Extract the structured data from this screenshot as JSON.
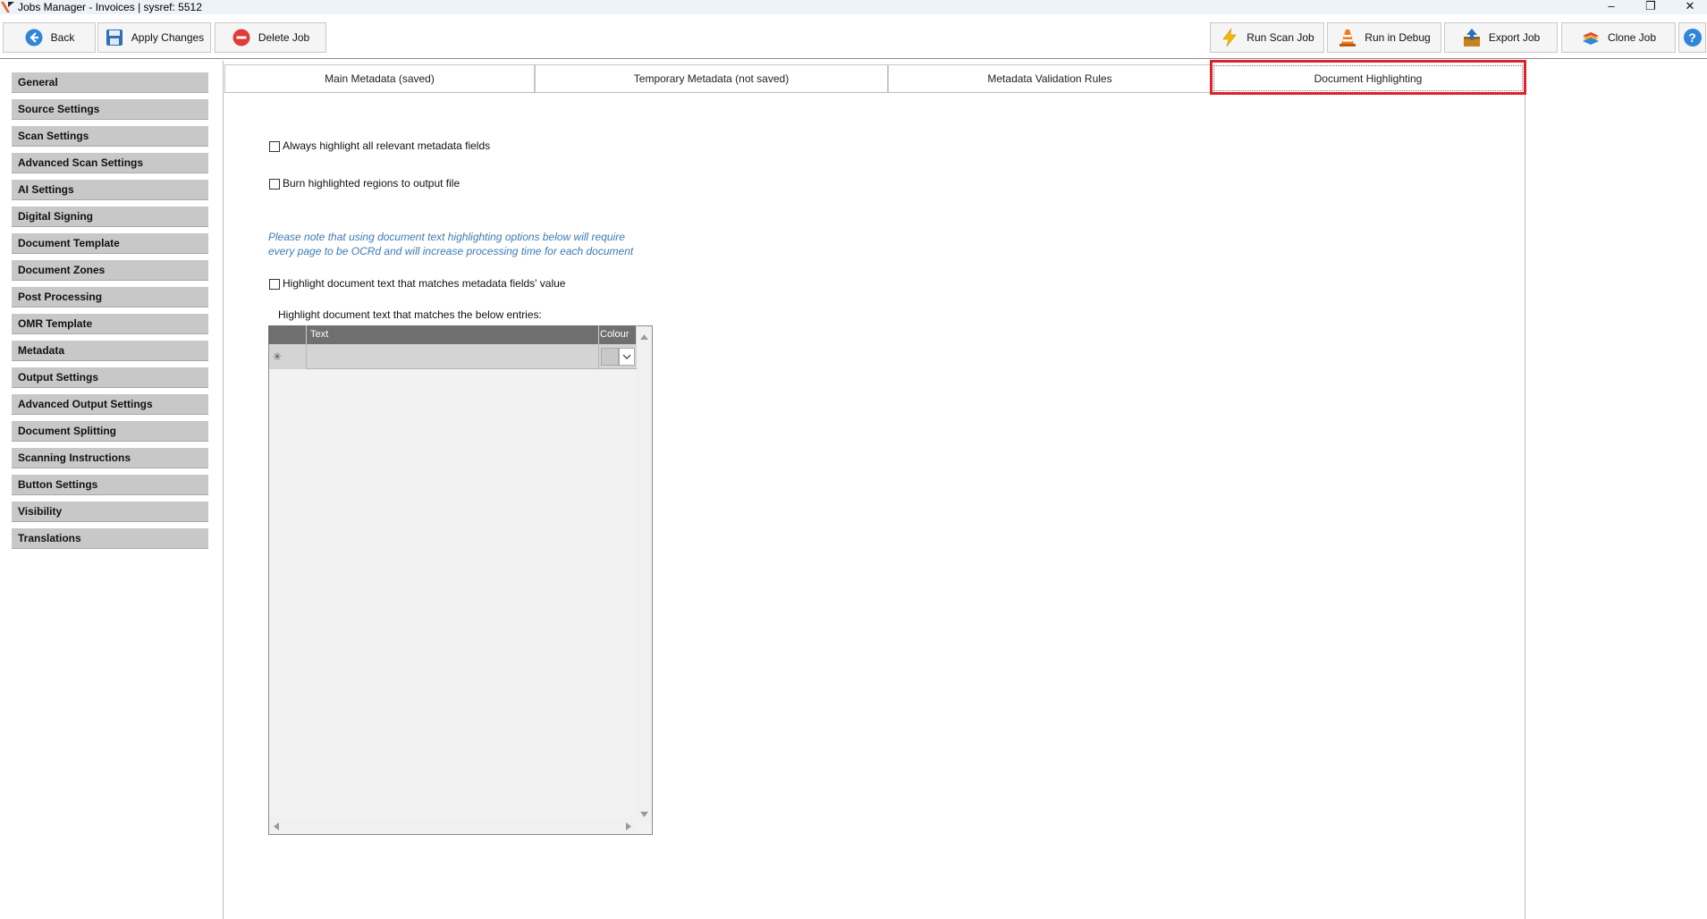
{
  "window": {
    "title": "Jobs Manager - Invoices  |  sysref: 5512",
    "minimize": "–",
    "restore": "❐",
    "close": "✕"
  },
  "toolbar": {
    "back": "Back",
    "apply_changes": "Apply Changes",
    "delete_job": "Delete Job",
    "run_scan_job": "Run Scan Job",
    "run_in_debug": "Run in Debug",
    "export_job": "Export Job",
    "clone_job": "Clone Job",
    "help": "?"
  },
  "sidebar": {
    "items": [
      "General",
      "Source Settings",
      "Scan Settings",
      "Advanced Scan Settings",
      "AI Settings",
      "Digital Signing",
      "Document Template",
      "Document Zones",
      "Post Processing",
      "OMR Template",
      "Metadata",
      "Output Settings",
      "Advanced Output Settings",
      "Document Splitting",
      "Scanning Instructions",
      "Button Settings",
      "Visibility",
      "Translations"
    ]
  },
  "tabs": {
    "main_metadata": "Main Metadata (saved)",
    "temporary_metadata": "Temporary Metadata (not saved)",
    "validation_rules": "Metadata Validation Rules",
    "document_highlighting": "Document Highlighting",
    "active": "Document Highlighting"
  },
  "highlighting": {
    "always_highlight_label": "Always highlight all relevant metadata fields",
    "always_highlight_checked": false,
    "burn_regions_label": "Burn highlighted regions to output file",
    "burn_regions_checked": false,
    "note_line1": "Please note that using document text highlighting options below will require",
    "note_line2": "every page to be OCRd and will increase processing time for each document",
    "match_metadata_label": "Highlight document text that matches metadata fields' value",
    "match_metadata_checked": false,
    "entries_label": "Highlight document text that matches the below entries:"
  },
  "grid": {
    "columns": [
      "Text",
      "Colour"
    ],
    "new_row_marker": "✳"
  },
  "colors": {
    "accent_highlight": "#e0202a",
    "note_text": "#3d7ab5",
    "sidebar_item_bg": "#c8c8c8",
    "grid_header_bg": "#6f6f6f"
  }
}
